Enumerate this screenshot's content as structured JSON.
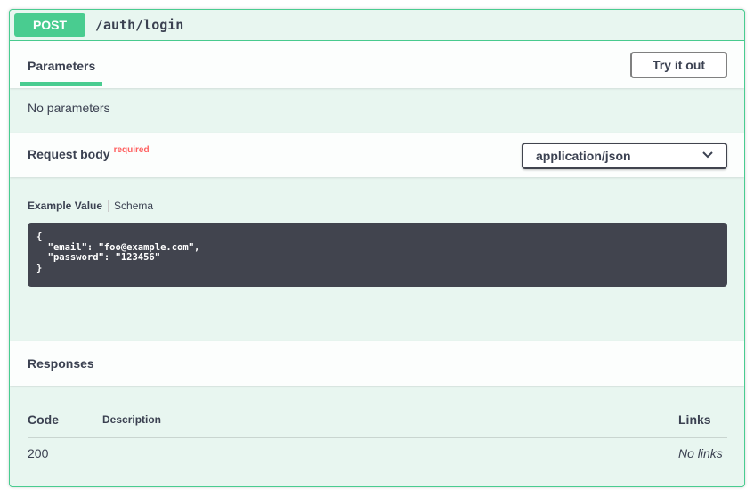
{
  "operation": {
    "method": "POST",
    "path": "/auth/login",
    "colors": {
      "method": "#49cc90"
    }
  },
  "parameters": {
    "tab_label": "Parameters",
    "try_label": "Try it out",
    "empty_text": "No parameters"
  },
  "request_body": {
    "title": "Request body",
    "required_label": "required",
    "content_type": "application/json",
    "example_tab": "Example Value",
    "schema_tab": "Schema",
    "example_code": "{\n  \"email\": \"foo@example.com\",\n  \"password\": \"123456\"\n}"
  },
  "responses": {
    "title": "Responses",
    "headers": {
      "code": "Code",
      "description": "Description",
      "links": "Links"
    },
    "rows": [
      {
        "code": "200",
        "description": "",
        "links": "No links"
      }
    ]
  }
}
